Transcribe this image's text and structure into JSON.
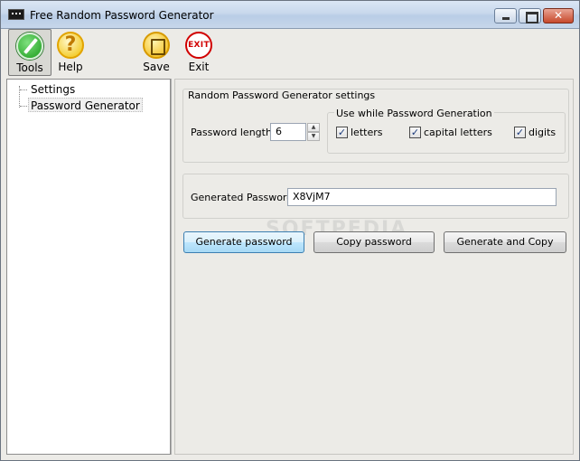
{
  "window": {
    "title": "Free Random Password Generator"
  },
  "toolbar": {
    "tools": "Tools",
    "help": "Help",
    "save": "Save",
    "exit": "Exit",
    "help_glyph": "?",
    "exit_glyph": "EXIT"
  },
  "tree": {
    "items": [
      "Settings",
      "Password Generator"
    ],
    "selected": "Password Generator"
  },
  "settings": {
    "group_title": "Random Password Generator settings",
    "length_label": "Password length",
    "length_value": "6",
    "use_group_title": "Use while Password Generation",
    "options": [
      {
        "label": "letters",
        "checked": true
      },
      {
        "label": "capital letters",
        "checked": true
      },
      {
        "label": "digits",
        "checked": true
      }
    ],
    "check_glyph": "✓"
  },
  "generated": {
    "label": "Generated Password:",
    "value": "X8VjM7"
  },
  "buttons": {
    "generate": "Generate password",
    "copy": "Copy password",
    "generate_copy": "Generate and Copy"
  },
  "watermark": "SOFTPEDIA"
}
